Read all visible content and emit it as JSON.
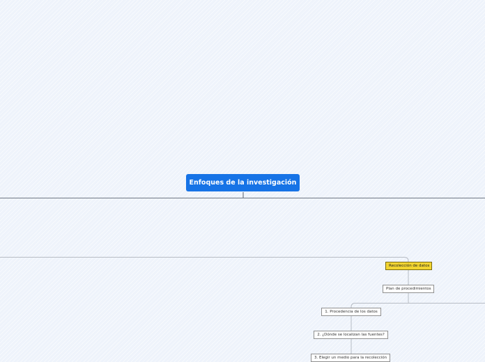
{
  "map": {
    "central_topic": "Enfoques de la investigación",
    "nodes": {
      "recoleccion": "Recolección de datos",
      "plan": "Plan de procedimientos",
      "step1": "1. Procedencia de los datos",
      "step2": "2. ¿Dónde se localizan las fuentes?",
      "step3": "3. Elegir un medio para la recolección"
    }
  },
  "colors": {
    "background": "#eef3fb",
    "central_fill": "#1673e6",
    "highlight_fill": "#f2d531",
    "connector": "#7d8591"
  }
}
